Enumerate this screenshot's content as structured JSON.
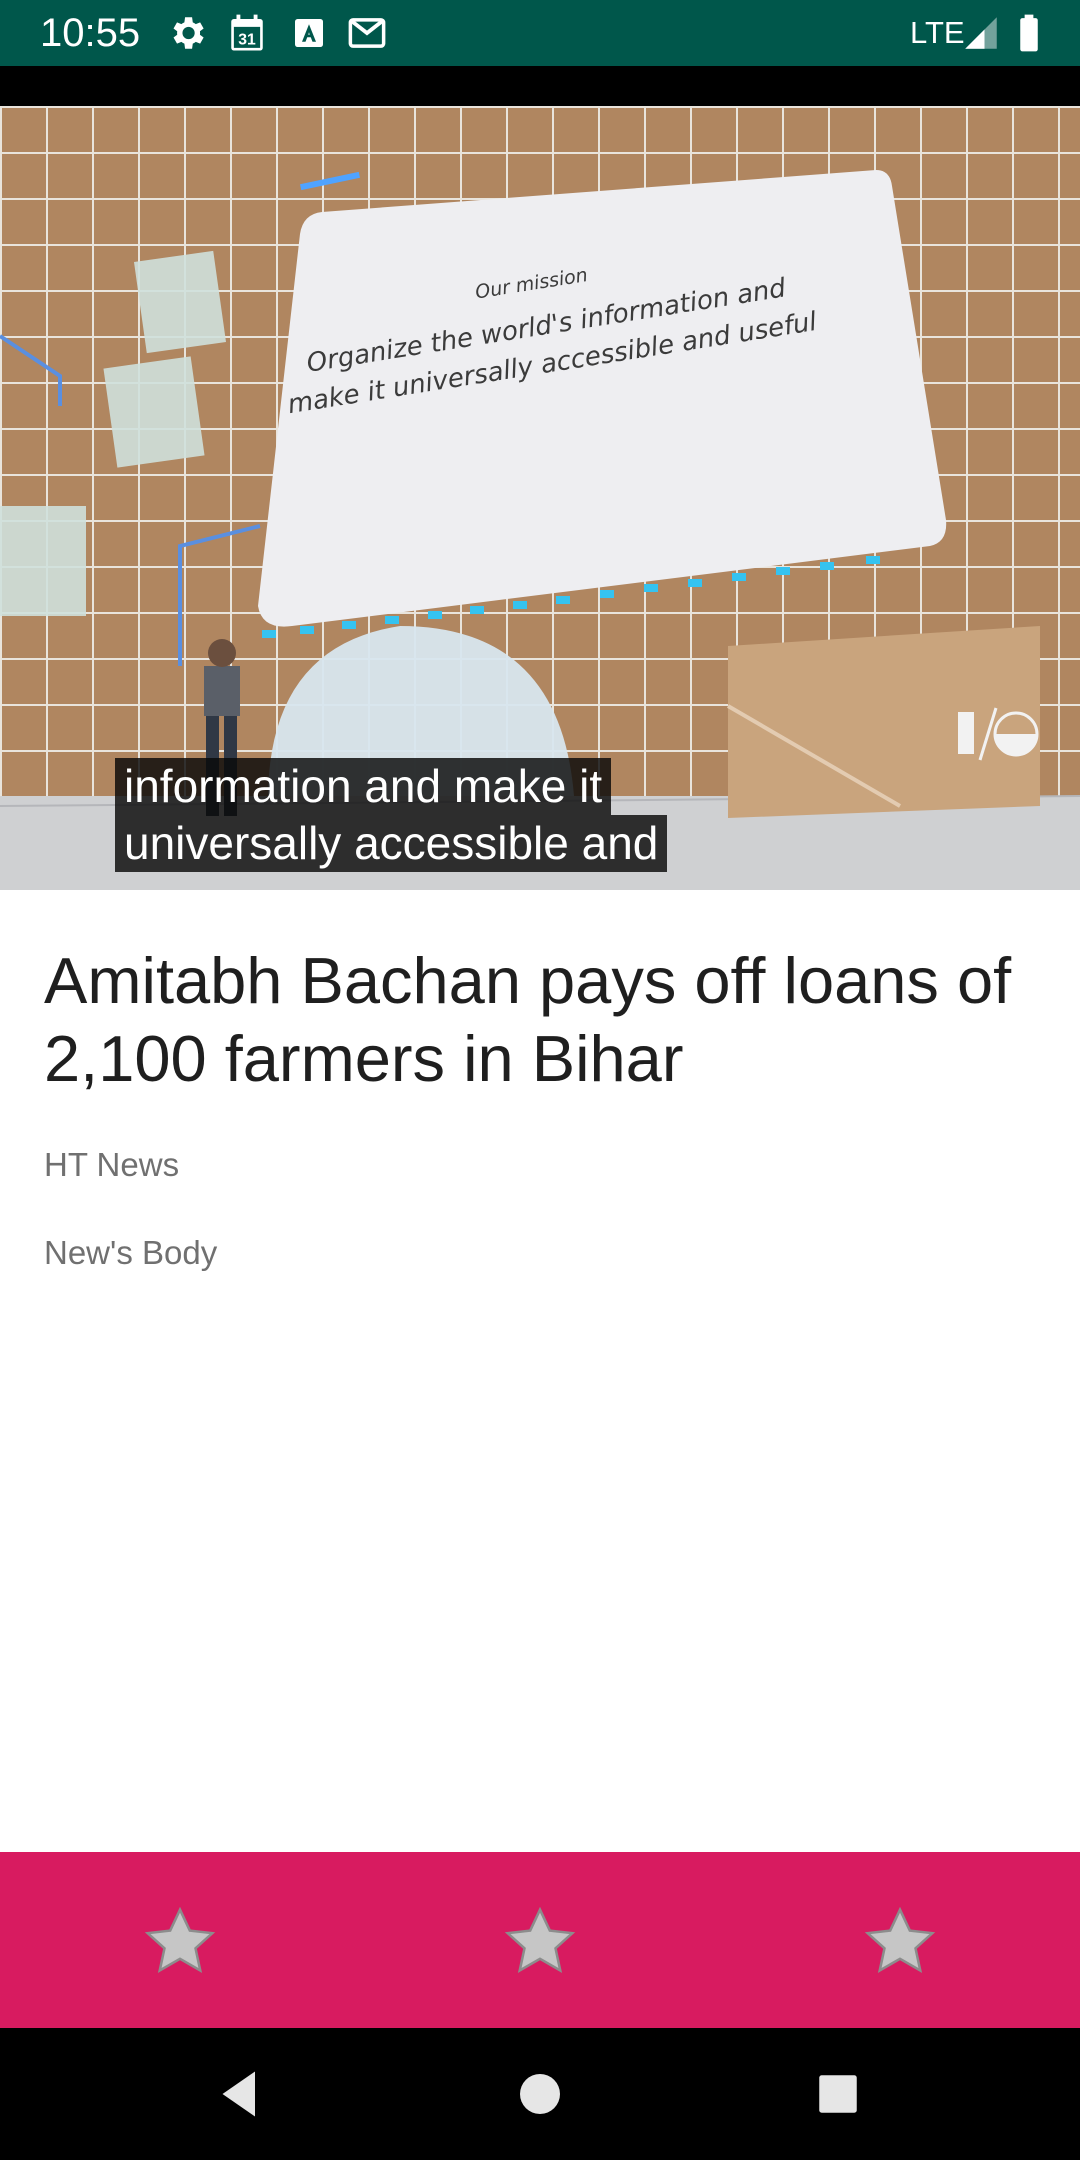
{
  "status_bar": {
    "time": "10:55",
    "network": "LTE",
    "icons": [
      "gear-icon",
      "calendar-icon",
      "text-a-icon",
      "gmail-icon",
      "signal-icon",
      "battery-icon"
    ],
    "calendar_day": "31",
    "background_color": "#00574b"
  },
  "video": {
    "slide_heading": "Our mission",
    "slide_line1": "Organize the world's information and",
    "slide_line2": "make it universally accessible and useful",
    "caption_line1": "information and make it",
    "caption_line2": "universally accessible and",
    "logo_text": "I/O"
  },
  "article": {
    "title": "Amitabh Bachan pays off loans of 2,100 farmers in Bihar",
    "source": "HT News",
    "body": "New's Body"
  },
  "rating_bar": {
    "background_color": "#d81b60",
    "stars": [
      "star-icon",
      "star-icon",
      "star-icon"
    ]
  },
  "nav_bar": {
    "buttons": [
      "back-icon",
      "home-icon",
      "recents-icon"
    ]
  }
}
